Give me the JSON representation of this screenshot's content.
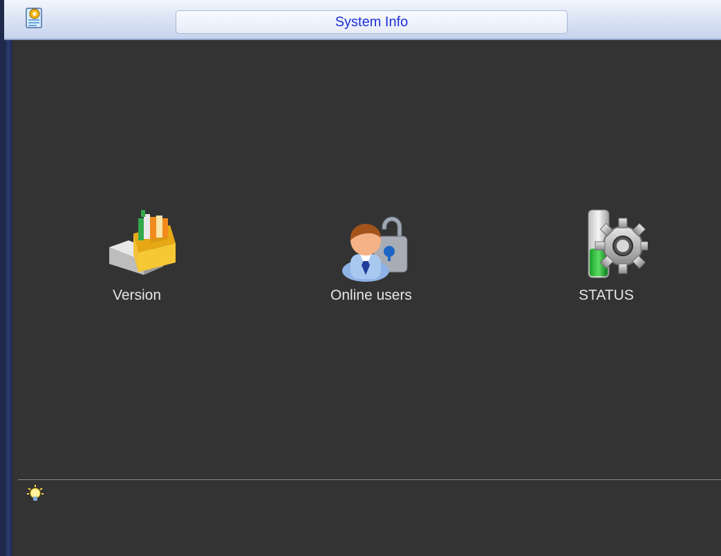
{
  "window": {
    "title": "System Info",
    "app_icon": "settings-document-icon"
  },
  "menu": {
    "items": [
      {
        "label": "Version",
        "icon": "version-folder-icon"
      },
      {
        "label": "Online users",
        "icon": "online-users-lock-icon"
      },
      {
        "label": "STATUS",
        "icon": "status-gear-icon"
      }
    ]
  },
  "hint": {
    "icon": "lightbulb-icon",
    "text": ""
  },
  "colors": {
    "title_text": "#1f2fd6",
    "background": "#333333",
    "label_text": "#e6e6e6"
  }
}
